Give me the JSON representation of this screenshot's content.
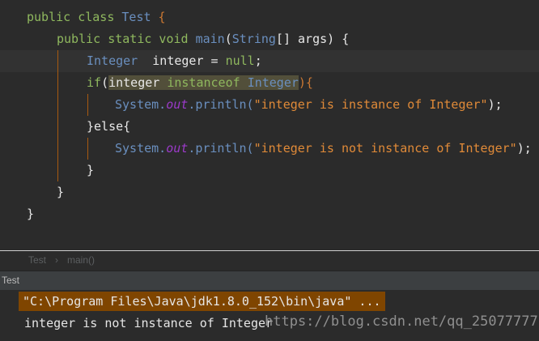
{
  "editor": {
    "lines": [
      {
        "t1": "public class ",
        "t2": "Test",
        " t3": " {"
      },
      {
        "t1": "public static void ",
        "t2": "main",
        "t3": "(",
        "t4": "String",
        "t5": "[] args) {"
      }
    ],
    "l1": {
      "a": "public class ",
      "b": "Test",
      "c": " {"
    },
    "l2": {
      "a": "public static void ",
      "b": "main",
      "c": "(",
      "d": "String",
      "e": "[] args) {"
    },
    "l3": {
      "a": "Integer",
      "b": "  integer = ",
      "c": "null",
      "d": ";"
    },
    "l4": {
      "a": "if",
      "b": "(",
      "c": "integer",
      "d": " instanceof ",
      "e": "Integer",
      "f": "){"
    },
    "l5": {
      "a": "System.",
      "b": "out",
      "c": ".println(",
      "d": "\"integer is instance of Integer\"",
      "e": ");"
    },
    "l6": {
      "a": "}else{"
    },
    "l7": {
      "a": "System.",
      "b": "out",
      "c": ".println(",
      "d": "\"integer is not instance of Integer\"",
      "e": ");"
    },
    "l8": {
      "a": "}"
    },
    "l9": {
      "a": "}"
    },
    "l10": {
      "a": "}"
    }
  },
  "breadcrumb": {
    "class": "Test",
    "sep": "›",
    "method": "main()"
  },
  "run_panel": {
    "title": "Test"
  },
  "console": {
    "command": "\"C:\\Program Files\\Java\\jdk1.8.0_152\\bin\\java\" ...",
    "output": "integer is not instance of Integer"
  },
  "watermark": "https://blog.csdn.net/qq_25077777"
}
